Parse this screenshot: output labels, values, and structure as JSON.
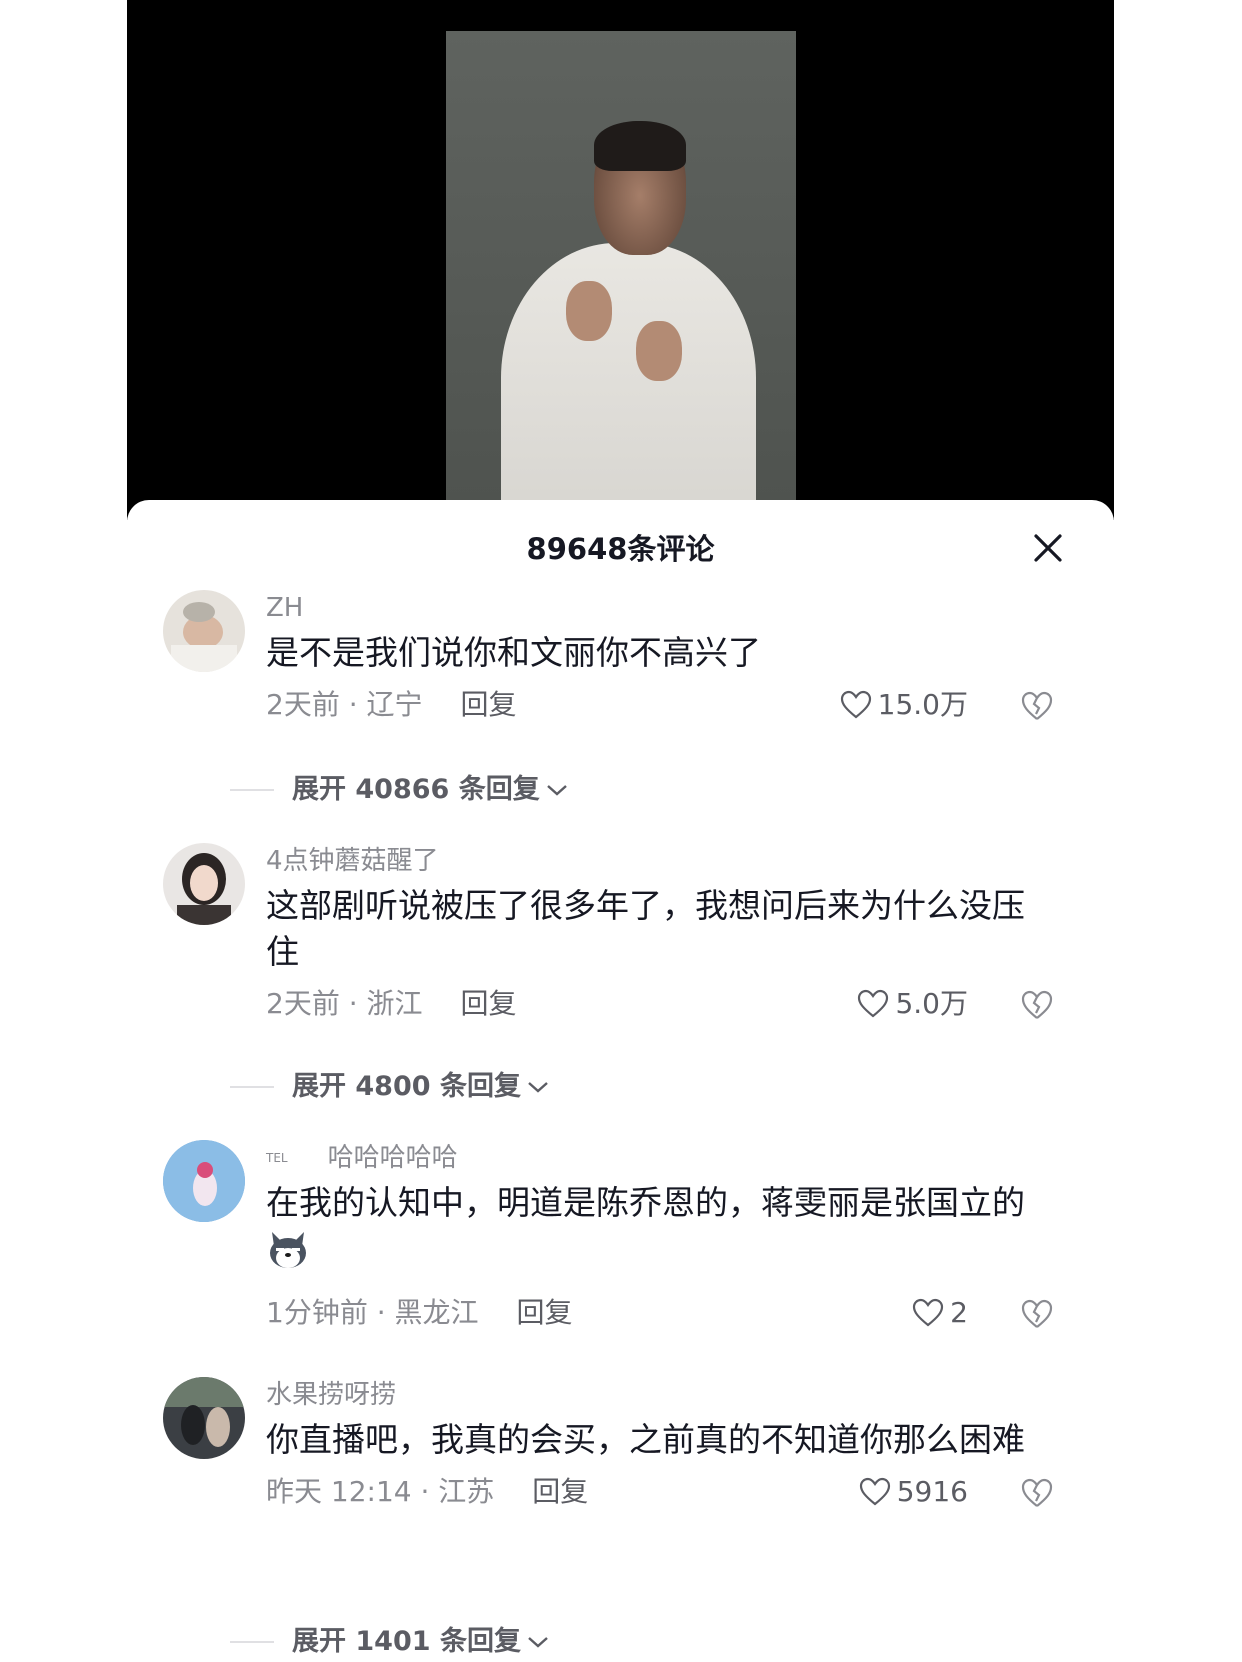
{
  "sheet": {
    "title": "89648条评论"
  },
  "comments": [
    {
      "name": "ZH",
      "tag": "",
      "text": "是不是我们说你和文丽你不高兴了",
      "meta": "2天前 · 辽宁",
      "reply_label": "回复",
      "likes": "15.0万",
      "expand": "展开 40866 条回复"
    },
    {
      "name": "4点钟蘑菇醒了",
      "tag": "",
      "text": "这部剧听说被压了很多年了，我想问后来为什么没压住",
      "meta": "2天前 · 浙江",
      "reply_label": "回复",
      "likes": "5.0万",
      "expand": "展开 4800 条回复"
    },
    {
      "name": "哈哈哈哈哈",
      "tag": "TEL",
      "text": "在我的认知中，明道是陈乔恩的，蒋雯丽是张国立的",
      "meta": "1分钟前 · 黑龙江",
      "reply_label": "回复",
      "likes": "2"
    },
    {
      "name": "水果捞呀捞",
      "tag": "",
      "text": "你直播吧，我真的会买，之前真的不知道你那么困难",
      "meta": "昨天 12:14 · 江苏",
      "reply_label": "回复",
      "likes": "5916",
      "expand": "展开 1401 条回复"
    }
  ],
  "icons": {
    "close": "close-icon",
    "like": "heart-outline-icon",
    "dislike": "broken-heart-icon",
    "expand": "chevron-down-icon"
  },
  "colors": {
    "text": "#161823",
    "muted": "#8a8b91",
    "video_bg": "#000000"
  }
}
